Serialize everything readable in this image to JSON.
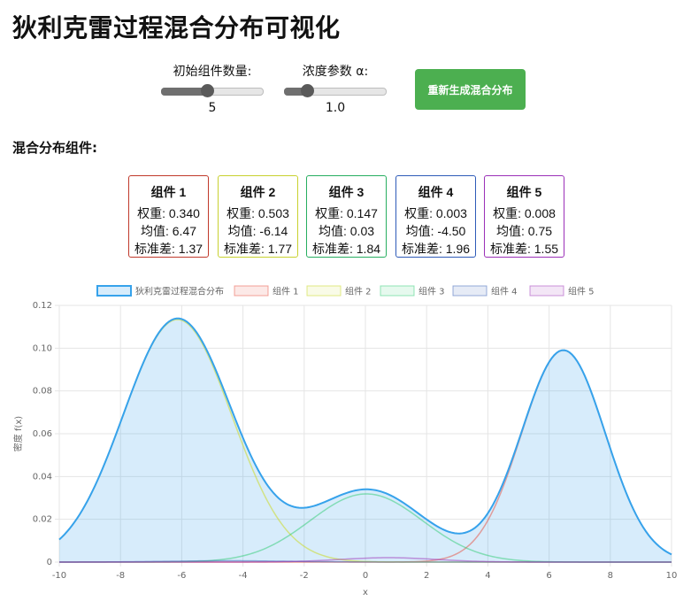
{
  "page": {
    "title": "狄利克雷过程混合分布可视化",
    "section_title": "混合分布组件:"
  },
  "controls": {
    "components": {
      "label": "初始组件数量:",
      "value": "5",
      "min": 1,
      "max": 10,
      "level": 5
    },
    "alpha": {
      "label": "浓度参数 α:",
      "value": "1.0",
      "min": 0.1,
      "max": 5,
      "level": 1.0
    },
    "regenerate_label": "重新生成混合分布"
  },
  "components": [
    {
      "title": "组件 1",
      "weight": "权重: 0.340",
      "mean": "均值: 6.47",
      "std": "标准差: 1.37",
      "color": "#c0392b"
    },
    {
      "title": "组件 2",
      "weight": "权重: 0.503",
      "mean": "均值: -6.14",
      "std": "标准差: 1.77",
      "color": "#c8d12f"
    },
    {
      "title": "组件 3",
      "weight": "权重: 0.147",
      "mean": "均值: 0.03",
      "std": "标准差: 1.84",
      "color": "#27ae60"
    },
    {
      "title": "组件 4",
      "weight": "权重: 0.003",
      "mean": "均值: -4.50",
      "std": "标准差: 1.96",
      "color": "#2e5bb8"
    },
    {
      "title": "组件 5",
      "weight": "权重: 0.008",
      "mean": "均值: 0.75",
      "std": "标准差: 1.55",
      "color": "#9b30b8"
    }
  ],
  "chart_data": {
    "type": "area",
    "xlabel": "x",
    "ylabel": "密度 f(x)",
    "xlim": [
      -10,
      10
    ],
    "ylim": [
      0,
      0.12
    ],
    "xticks": [
      "-10",
      "-8",
      "-6",
      "-4",
      "-2",
      "0",
      "2",
      "4",
      "6",
      "8",
      "10"
    ],
    "yticks": [
      "0",
      "0.02",
      "0.04",
      "0.06",
      "0.08",
      "0.10",
      "0.12"
    ],
    "grid": true,
    "legend_position": "top",
    "series": [
      {
        "name": "狄利克雷过程混合分布",
        "kind": "mixture",
        "color": "#36a2eb",
        "fill": "rgba(54,162,235,0.2)"
      },
      {
        "name": "组件 1",
        "weight": 0.34,
        "mean": 6.47,
        "std": 1.37,
        "color": "rgba(231,76,60,0.5)",
        "fill": "rgba(231,76,60,0.12)"
      },
      {
        "name": "组件 2",
        "weight": 0.503,
        "mean": -6.14,
        "std": 1.77,
        "color": "rgba(205,220,57,0.6)",
        "fill": "rgba(205,220,57,0.12)"
      },
      {
        "name": "组件 3",
        "weight": 0.147,
        "mean": 0.03,
        "std": 1.84,
        "color": "rgba(46,204,113,0.5)",
        "fill": "rgba(46,204,113,0.12)"
      },
      {
        "name": "组件 4",
        "weight": 0.003,
        "mean": -4.5,
        "std": 1.96,
        "color": "rgba(52,94,180,0.5)",
        "fill": "rgba(52,94,180,0.12)"
      },
      {
        "name": "组件 5",
        "weight": 0.008,
        "mean": 0.75,
        "std": 1.55,
        "color": "rgba(155,48,184,0.5)",
        "fill": "rgba(155,48,184,0.12)"
      }
    ]
  }
}
